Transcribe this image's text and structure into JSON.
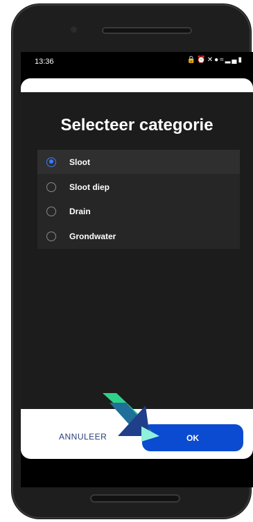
{
  "statusbar": {
    "time": "13:36",
    "icons": [
      "lock-icon",
      "alarm-icon",
      "mute-icon",
      "location-icon",
      "wifi-icon",
      "signal-icon",
      "battery-icon"
    ]
  },
  "dialog": {
    "title": "Selecteer categorie",
    "options": [
      {
        "label": "Sloot",
        "selected": true
      },
      {
        "label": "Sloot diep",
        "selected": false
      },
      {
        "label": "Drain",
        "selected": false
      },
      {
        "label": "Grondwater",
        "selected": false
      }
    ],
    "cancel_label": "ANNULEER",
    "ok_label": "OK"
  },
  "colors": {
    "accent": "#0b4bd1",
    "radio_selected": "#3b7bff",
    "dialog_bg": "#1c1c1c"
  }
}
